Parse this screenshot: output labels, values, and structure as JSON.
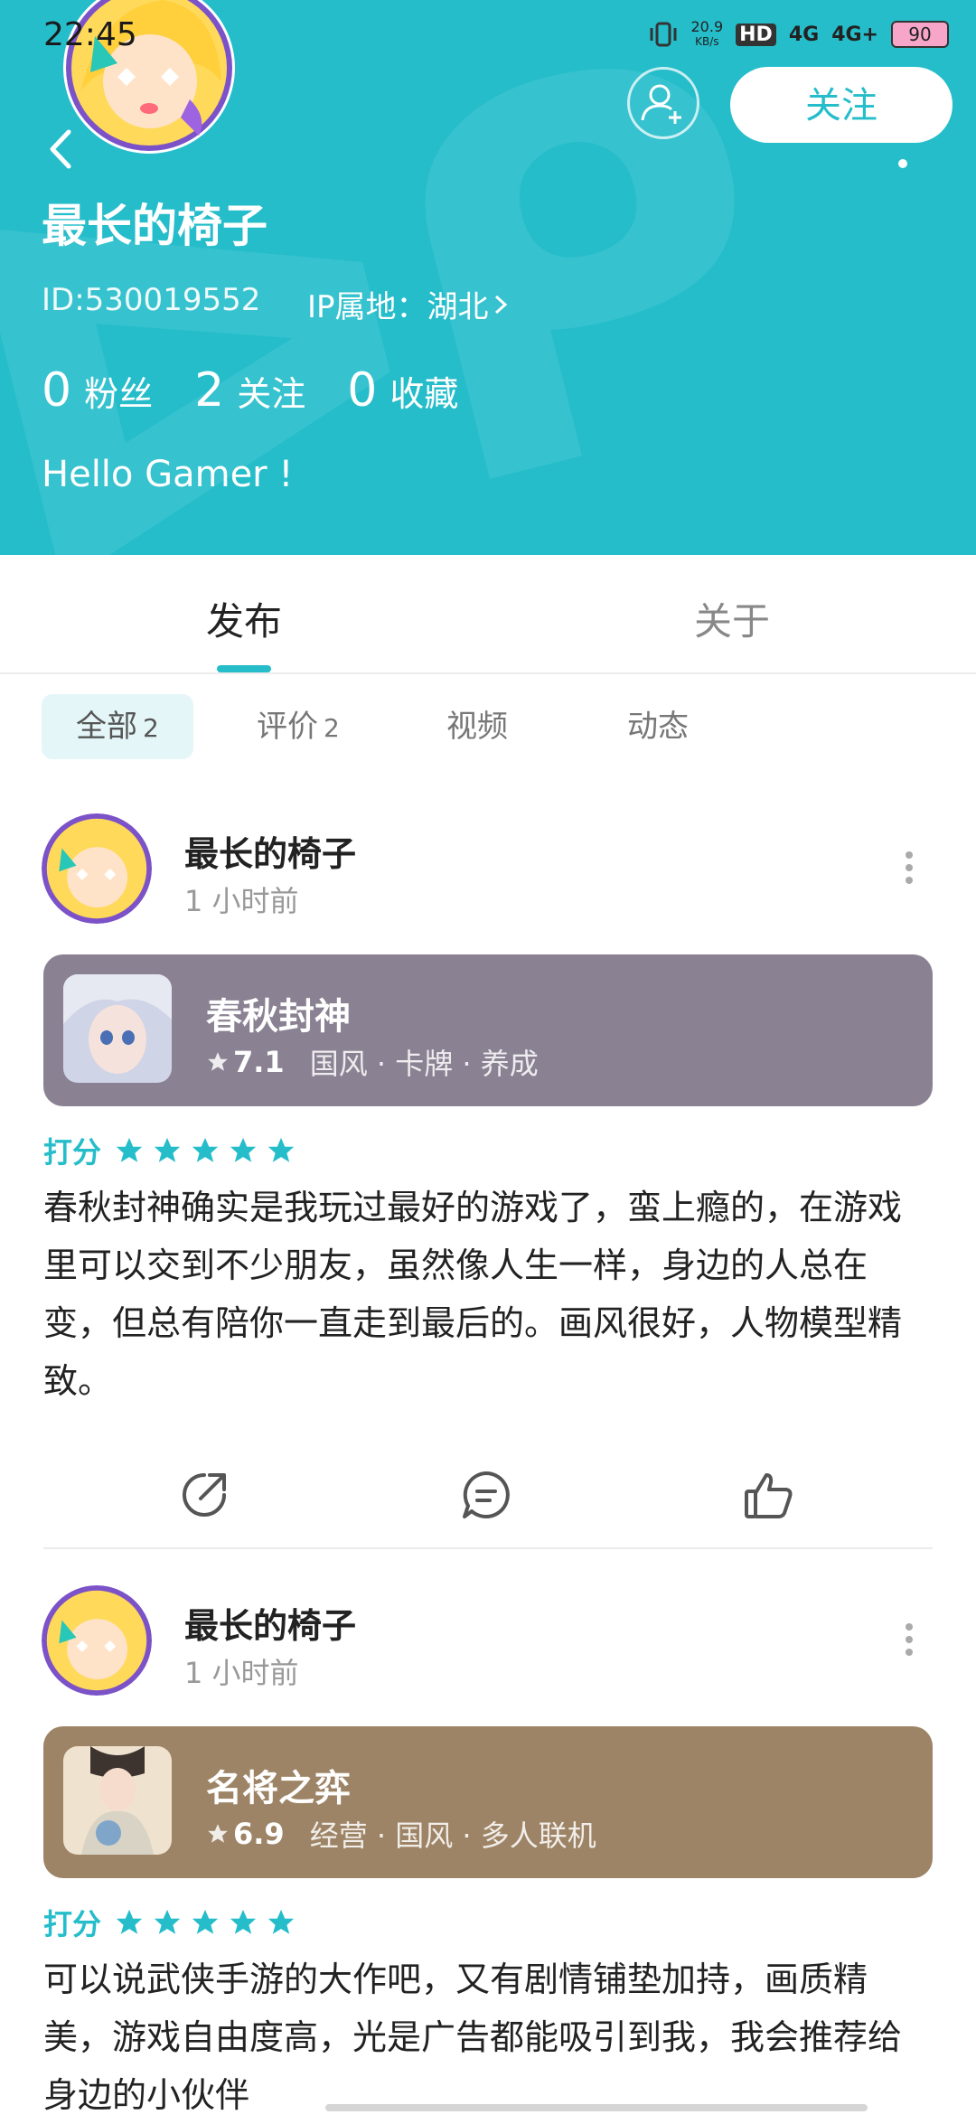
{
  "status_bar": {
    "time": "22:45",
    "net_speed_value": "20.9",
    "net_speed_unit": "KB/s",
    "hd_label": "HD",
    "signal_1": "4G",
    "signal_2": "4G+",
    "battery": "90"
  },
  "header": {
    "name": "最长的椅子",
    "id_text": "ID:530019552",
    "ip_text": "IP属地：湖北",
    "follow_label": "关注",
    "bio": "Hello Gamer !",
    "stats": [
      {
        "value": "0",
        "label": "粉丝"
      },
      {
        "value": "2",
        "label": "关注"
      },
      {
        "value": "0",
        "label": "收藏"
      }
    ],
    "bg_color": "#25bdca"
  },
  "tabs": {
    "publish": "发布",
    "about": "关于"
  },
  "filters": [
    {
      "label": "全部",
      "count": "2"
    },
    {
      "label": "评价",
      "count": "2"
    },
    {
      "label": "视频",
      "count": ""
    },
    {
      "label": "动态",
      "count": ""
    }
  ],
  "posts": [
    {
      "author": "最长的椅子",
      "time": "1 小时前",
      "game": {
        "title": "春秋封神",
        "score": "7.1",
        "tags": "国风 · 卡牌 · 养成",
        "color": "#8a8192"
      },
      "rating_label": "打分",
      "stars": 5,
      "text": "春秋封神确实是我玩过最好的游戏了，蛮上瘾的，在游戏里可以交到不少朋友，虽然像人生一样，身边的人总在变，但总有陪你一直走到最后的。画风很好，人物模型精致。"
    },
    {
      "author": "最长的椅子",
      "time": "1 小时前",
      "game": {
        "title": "名将之弈",
        "score": "6.9",
        "tags": "经营 · 国风 · 多人联机",
        "color": "#9e8466"
      },
      "rating_label": "打分",
      "stars": 5,
      "text": "可以说武侠手游的大作吧，又有剧情铺垫加持，画质精美，游戏自由度高，光是广告都能吸引到我，我会推荐给身边的小伙伴"
    }
  ],
  "icons": {
    "back": "chevron-left-icon",
    "add_friend": "add-friend-icon",
    "share": "share-icon",
    "comment": "comment-icon",
    "like": "thumbs-up-icon",
    "more": "more-vertical-icon",
    "star": "star-icon"
  },
  "colors": {
    "accent": "#25bdca",
    "chip_active_bg": "#e5f6f8"
  }
}
